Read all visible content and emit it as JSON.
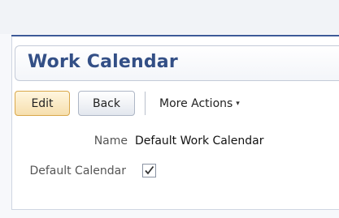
{
  "header": {
    "title": "Work Calendar"
  },
  "toolbar": {
    "edit_label": "Edit",
    "back_label": "Back",
    "more_actions_label": "More Actions",
    "more_actions_caret": "▾"
  },
  "fields": {
    "name_label": "Name",
    "name_value": "Default Work Calendar",
    "default_calendar_label": "Default Calendar",
    "default_calendar_checked": true
  },
  "colors": {
    "accent": "#334f86",
    "edit_button": "#f6dfae"
  },
  "icons": {
    "checkbox": "checkmark-icon",
    "more_actions": "chevron-down-icon"
  }
}
